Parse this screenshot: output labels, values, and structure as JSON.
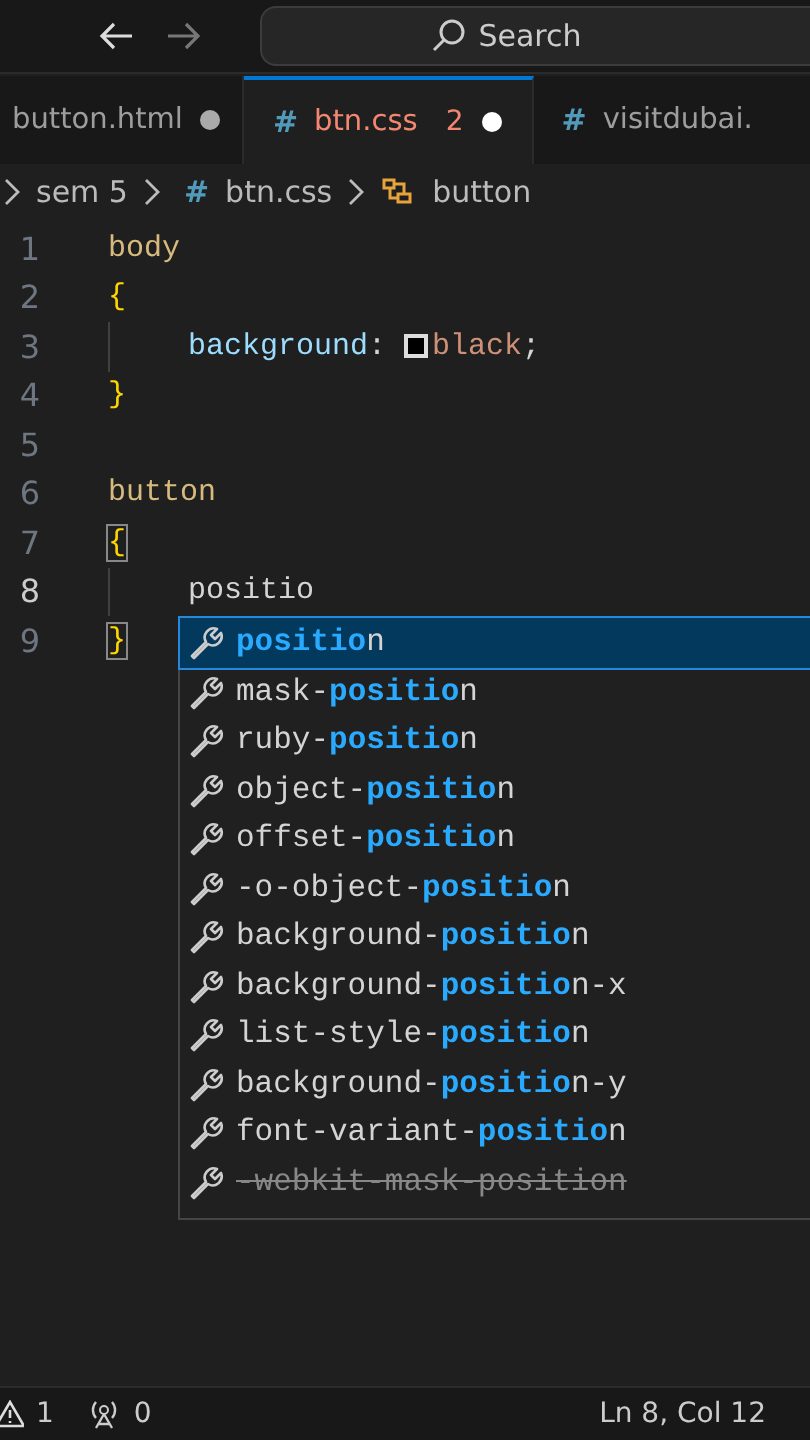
{
  "title_bar": {
    "search": {
      "placeholder": "Search"
    }
  },
  "tabs": [
    {
      "label": "button.html",
      "kind": "html",
      "selected": false,
      "modified": true
    },
    {
      "label": "btn.css",
      "kind": "css",
      "icon": "#",
      "selected": true,
      "modified": true,
      "problems": "2"
    },
    {
      "label": "visitdubai.",
      "kind": "css",
      "icon": "#",
      "selected": false,
      "modified": false
    }
  ],
  "breadcrumb": [
    {
      "label": "sem 5",
      "kind": "folder"
    },
    {
      "label": "btn.css",
      "kind": "css",
      "icon": "#"
    },
    {
      "label": "button",
      "kind": "symbol"
    }
  ],
  "lines": [
    {
      "number": "1",
      "selected": false,
      "indented": false,
      "tokens": [
        {
          "kind": "selector",
          "text": "body"
        }
      ]
    },
    {
      "number": "2",
      "selected": false,
      "indented": false,
      "tokens": [
        {
          "kind": "brace",
          "text": "{"
        }
      ]
    },
    {
      "number": "3",
      "selected": false,
      "indented": true,
      "tokens": [
        {
          "kind": "property",
          "text": "background"
        },
        {
          "kind": "punct",
          "text": ": "
        },
        {
          "kind": "swatch",
          "color": "#000000"
        },
        {
          "kind": "value",
          "text": "black"
        },
        {
          "kind": "punct",
          "text": ";"
        }
      ]
    },
    {
      "number": "4",
      "selected": false,
      "indented": false,
      "tokens": [
        {
          "kind": "brace",
          "text": "}"
        }
      ]
    },
    {
      "number": "5",
      "selected": false,
      "indented": false
    },
    {
      "number": "6",
      "selected": false,
      "indented": false,
      "tokens": [
        {
          "kind": "selector",
          "text": "button"
        }
      ]
    },
    {
      "number": "7",
      "selected": false,
      "indented": false,
      "tokens": [
        {
          "kind": "brace-match",
          "text": "{"
        }
      ]
    },
    {
      "number": "8",
      "selected": true,
      "indented": true,
      "tokens": [
        {
          "kind": "text",
          "text": "positio"
        }
      ]
    },
    {
      "number": "9",
      "selected": false,
      "indented": false,
      "tokens": [
        {
          "kind": "brace-match",
          "text": "}"
        }
      ]
    }
  ],
  "suggestions": [
    {
      "text": "**positio**n",
      "selected": true,
      "deprecated": false
    },
    {
      "text": "mask-**positio**n",
      "selected": false,
      "deprecated": false
    },
    {
      "text": "ruby-**positio**n",
      "selected": false,
      "deprecated": false
    },
    {
      "text": "object-**positio**n",
      "selected": false,
      "deprecated": false
    },
    {
      "text": "offset-**positio**n",
      "selected": false,
      "deprecated": false
    },
    {
      "text": "-o-object-**positio**n",
      "selected": false,
      "deprecated": false
    },
    {
      "text": "background-**positio**n",
      "selected": false,
      "deprecated": false
    },
    {
      "text": "background-**positio**n-x",
      "selected": false,
      "deprecated": false
    },
    {
      "text": "list-style-**positio**n",
      "selected": false,
      "deprecated": false
    },
    {
      "text": "background-**positio**n-y",
      "selected": false,
      "deprecated": false
    },
    {
      "text": "font-variant-**positio**n",
      "selected": false,
      "deprecated": false
    },
    {
      "text": "-webkit-mask-position",
      "selected": false,
      "deprecated": true
    }
  ],
  "status_bar": {
    "warnings": "1",
    "ports": "0",
    "position": "Ln 8, Col 12"
  }
}
